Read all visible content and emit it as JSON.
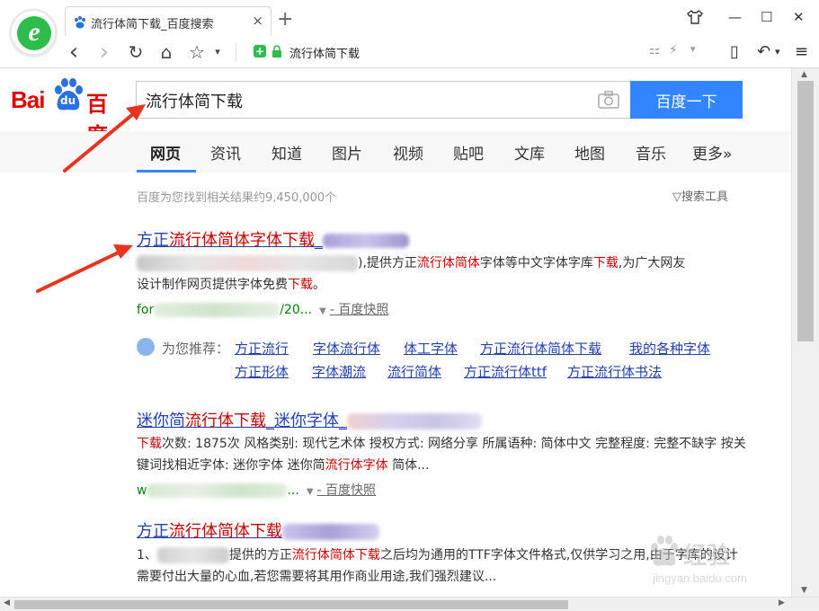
{
  "browser": {
    "tab_title": "流行体简下载_百度搜索",
    "tab_close": "×",
    "new_tab": "+",
    "window_controls": [
      "⌄",
      "—",
      "☐",
      "✕"
    ],
    "address": "流行体简下载",
    "shield_mark": "+"
  },
  "nav": {
    "back": "‹",
    "forward": "›",
    "reload": "↻",
    "home": "⌂",
    "star": "☆",
    "star_dropdown": "▾",
    "tools": [
      "⚏",
      "⚡",
      "▾"
    ],
    "right_tools": [
      "▯",
      "↶",
      "▾",
      "≡"
    ]
  },
  "baidu": {
    "logo_latin": "Bai",
    "logo_du": "du",
    "logo_cn": "百度",
    "query": "流行体简下载",
    "search_button": "百度一下",
    "tabs": [
      "网页",
      "资讯",
      "知道",
      "图片",
      "视频",
      "贴吧",
      "文库",
      "地图",
      "音乐",
      "更多»"
    ],
    "result_count": "百度为您找到相关结果约9,450,000个",
    "search_tools": "▽搜索工具"
  },
  "results": [
    {
      "title_parts": [
        "方正",
        "流行体简体字体下载",
        "_"
      ],
      "desc_parts": [
        "),提供方正",
        "流行体简体",
        "字体等中文字体字库",
        "下载",
        ",为广大网友",
        "设计制作网页提供字体免费",
        "下载",
        "。"
      ],
      "url_prefix": "for",
      "url_suffix": "/20...",
      "snapshot": "- 百度快照"
    },
    {
      "title_parts": [
        "迷你简",
        "流行体下载",
        "_迷你字体_"
      ],
      "desc_parts": [
        "下载",
        "次数: 1875次 风格类别: 现代艺术体 授权方式: 网络分享 所属语种: 简体中文 完整程度: 完整不缺字 按关键词找相近字体: 迷你字体 迷你简",
        "流行体字体",
        " 简体..."
      ],
      "url_prefix": "w",
      "url_suffix": "...",
      "snapshot": "- 百度快照"
    },
    {
      "title_parts": [
        "方正",
        "流行体简体下载"
      ],
      "desc_parts": [
        "1、",
        "提供的方正",
        "流行体简体下载",
        "之后均为通用的TTF字体文件格式,仅供学习之用,由于字库的设计需要付出大量的心血,若您需要将其用作商业用途,我们强烈建议..."
      ]
    }
  ],
  "recommend": {
    "label": "为您推荐：",
    "links": [
      "方正流行",
      "字体流行体",
      "体工字体",
      "方正流行体简体下载",
      "我的各种字体",
      "方正形体",
      "字体潮流",
      "流行简体",
      "方正流行体ttf",
      "方正流行体书法"
    ]
  },
  "watermark": {
    "main": "经验",
    "sub": "jingyan.baidu.com"
  },
  "scroll": {
    "up": "▲",
    "down": "▼",
    "left": "◀",
    "right": "▶"
  },
  "colors": {
    "brand_red": "#e10602",
    "link_blue": "#2440b3",
    "button_blue": "#3385ff",
    "highlight_red": "#c00",
    "url_green": "#008000",
    "annotation_red": "#e8341f"
  }
}
